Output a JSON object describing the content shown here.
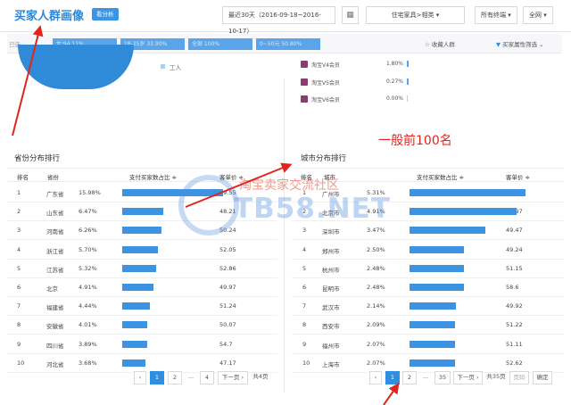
{
  "header": {
    "title": "买家人群画像",
    "badge": "看分析",
    "date_range": "最近30天（2016-09-18~2016-10-17）",
    "category": "住宅家具>相类",
    "terminal": "所有终端",
    "scope": "全网"
  },
  "filter_bar": {
    "label": "已选",
    "chips": [
      "女 94.11%",
      "18-25岁 33.90%",
      "全部 100%",
      "0~50元 50.80%"
    ],
    "favorite": "收藏人群",
    "attr_filter": "买家属性筛选"
  },
  "legend": {
    "worker": "工人"
  },
  "member_levels": [
    {
      "label": "淘宝V4会员",
      "pct": "1.80%",
      "share": 0.018
    },
    {
      "label": "淘宝V5会员",
      "pct": "0.27%",
      "share": 0.0027
    },
    {
      "label": "淘宝V6会员",
      "pct": "0.00%",
      "share": 0
    }
  ],
  "annotation": "一般前100名",
  "watermark": {
    "cn": "淘宝卖家交流社区",
    "en": "TB58.NET"
  },
  "province_table": {
    "title": "省份分布排行",
    "headers": [
      "排名",
      "省份",
      "支付买家数占比 ≑",
      "客单价 ≑"
    ],
    "rows": [
      {
        "rank": "1",
        "name": "广东省",
        "pct": "15.98%",
        "value": 15.98,
        "price": "49.55"
      },
      {
        "rank": "2",
        "name": "山东省",
        "pct": "6.47%",
        "value": 6.47,
        "price": "48.21"
      },
      {
        "rank": "3",
        "name": "河南省",
        "pct": "6.26%",
        "value": 6.26,
        "price": "50.24"
      },
      {
        "rank": "4",
        "name": "浙江省",
        "pct": "5.70%",
        "value": 5.7,
        "price": "52.05"
      },
      {
        "rank": "5",
        "name": "江苏省",
        "pct": "5.32%",
        "value": 5.32,
        "price": "52.86"
      },
      {
        "rank": "6",
        "name": "北京",
        "pct": "4.91%",
        "value": 4.91,
        "price": "49.97"
      },
      {
        "rank": "7",
        "name": "福建省",
        "pct": "4.44%",
        "value": 4.44,
        "price": "51.24"
      },
      {
        "rank": "8",
        "name": "安徽省",
        "pct": "4.01%",
        "value": 4.01,
        "price": "50.07"
      },
      {
        "rank": "9",
        "name": "四川省",
        "pct": "3.89%",
        "value": 3.89,
        "price": "54.7"
      },
      {
        "rank": "10",
        "name": "河北省",
        "pct": "3.68%",
        "value": 3.68,
        "price": "47.17"
      }
    ],
    "pagination": {
      "prev": "‹",
      "pages": [
        "1",
        "2",
        "...",
        "4"
      ],
      "next": "下一页 ›",
      "total": "共4页"
    }
  },
  "city_table": {
    "title": "城市分布排行",
    "headers": [
      "排名",
      "城市",
      "支付买家数占比 ≑",
      "客单价 ≑"
    ],
    "rows": [
      {
        "rank": "1",
        "name": "广州市",
        "pct": "5.31%",
        "value": 5.31,
        "price": "49.25"
      },
      {
        "rank": "2",
        "name": "北京市",
        "pct": "4.91%",
        "value": 4.91,
        "price": "49.97"
      },
      {
        "rank": "3",
        "name": "深圳市",
        "pct": "3.47%",
        "value": 3.47,
        "price": "49.47"
      },
      {
        "rank": "4",
        "name": "郑州市",
        "pct": "2.50%",
        "value": 2.5,
        "price": "49.24"
      },
      {
        "rank": "5",
        "name": "杭州市",
        "pct": "2.48%",
        "value": 2.48,
        "price": "51.15"
      },
      {
        "rank": "6",
        "name": "昆明市",
        "pct": "2.48%",
        "value": 2.48,
        "price": "58.6"
      },
      {
        "rank": "7",
        "name": "武汉市",
        "pct": "2.14%",
        "value": 2.14,
        "price": "49.92"
      },
      {
        "rank": "8",
        "name": "西安市",
        "pct": "2.09%",
        "value": 2.09,
        "price": "51.22"
      },
      {
        "rank": "9",
        "name": "福州市",
        "pct": "2.07%",
        "value": 2.07,
        "price": "51.11"
      },
      {
        "rank": "10",
        "name": "上海市",
        "pct": "2.07%",
        "value": 2.07,
        "price": "52.62"
      }
    ],
    "pagination": {
      "prev": "‹",
      "pages": [
        "1",
        "2",
        "...",
        "35"
      ],
      "next": "下一页 ›",
      "total": "共35页",
      "goto": "页码",
      "confirm": "确定"
    }
  },
  "colors": {
    "accent": "#3c93e2",
    "annotation": "#e0251d"
  },
  "icons": [
    "calendar-icon",
    "dropdown-icon",
    "star-icon",
    "filter-icon",
    "member-level-icon",
    "arrow-annotation"
  ]
}
